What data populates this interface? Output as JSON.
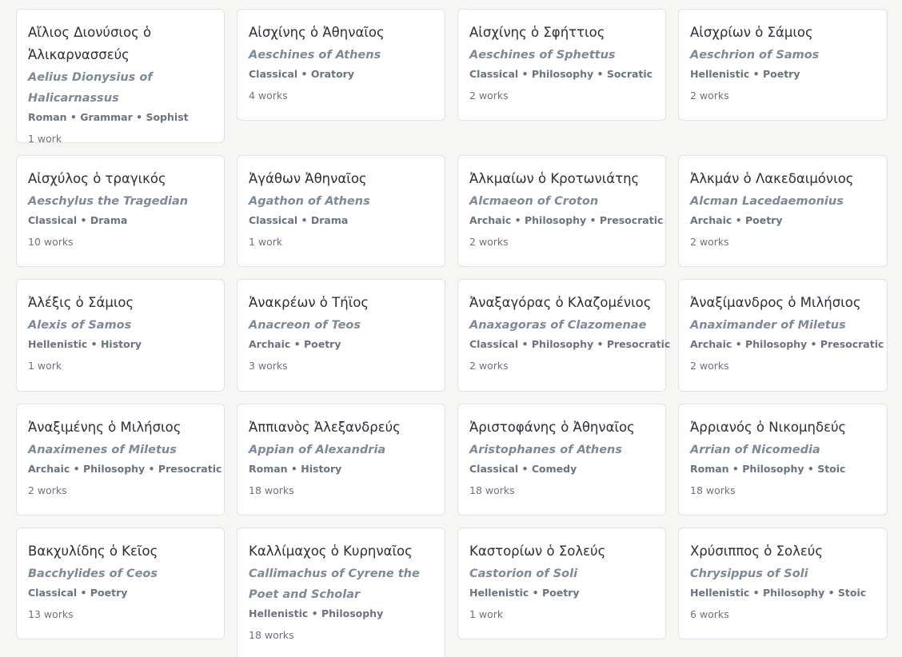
{
  "authors": [
    {
      "greek": "Αἴλιος Διονύσιος ὁ Ἁλικαρνασσεύς",
      "english": "Aelius Dionysius of Halicarnassus",
      "meta": "Roman • Grammar • Sophist",
      "works": "1 work"
    },
    {
      "greek": "Αἰσχίνης ὁ Ἀθηναῖος",
      "english": "Aeschines of Athens",
      "meta": "Classical • Oratory",
      "works": "4 works"
    },
    {
      "greek": "Αἰσχίνης ὁ Σφήττιος",
      "english": "Aeschines of Sphettus",
      "meta": "Classical • Philosophy • Socratic",
      "works": "2 works"
    },
    {
      "greek": "Αἰσχρίων ὁ Σάμιος",
      "english": "Aeschrion of Samos",
      "meta": "Hellenistic • Poetry",
      "works": "2 works"
    },
    {
      "greek": "Αἰσχύλος ὁ τραγικός",
      "english": "Aeschylus the Tragedian",
      "meta": "Classical • Drama",
      "works": "10 works"
    },
    {
      "greek": "Ἀγάθων Ἀθηναῖος",
      "english": "Agathon of Athens",
      "meta": "Classical • Drama",
      "works": "1 work"
    },
    {
      "greek": "Ἀλκμαίων ὁ Κροτωνιάτης",
      "english": "Alcmaeon of Croton",
      "meta": "Archaic • Philosophy • Presocratic",
      "works": "2 works"
    },
    {
      "greek": "Ἀλκμάν ὁ Λακεδαιμόνιος",
      "english": "Alcman Lacedaemonius",
      "meta": "Archaic • Poetry",
      "works": "2 works"
    },
    {
      "greek": "Ἀλέξις ὁ Σάμιος",
      "english": "Alexis of Samos",
      "meta": "Hellenistic • History",
      "works": "1 work"
    },
    {
      "greek": "Ἀνακρέων ὁ Τήϊος",
      "english": "Anacreon of Teos",
      "meta": "Archaic • Poetry",
      "works": "3 works"
    },
    {
      "greek": "Ἀναξαγόρας ὁ Κλαζομένιος",
      "english": "Anaxagoras of Clazomenae",
      "meta": "Classical • Philosophy • Presocratic",
      "works": "2 works"
    },
    {
      "greek": "Ἀναξίμανδρος ὁ Μιλήσιος",
      "english": "Anaximander of Miletus",
      "meta": "Archaic • Philosophy • Presocratic",
      "works": "2 works"
    },
    {
      "greek": "Ἀναξιμένης ὁ Μιλήσιος",
      "english": "Anaximenes of Miletus",
      "meta": "Archaic • Philosophy • Presocratic",
      "works": "2 works"
    },
    {
      "greek": "Ἀππιανὸς Ἀλεξανδρεύς",
      "english": "Appian of Alexandria",
      "meta": "Roman • History",
      "works": "18 works"
    },
    {
      "greek": "Ἀριστοφάνης ὁ Ἀθηναῖος",
      "english": "Aristophanes of Athens",
      "meta": "Classical • Comedy",
      "works": "18 works"
    },
    {
      "greek": "Ἀρριανός ὁ Νικομηδεύς",
      "english": "Arrian of Nicomedia",
      "meta": "Roman • Philosophy • Stoic",
      "works": "18 works"
    },
    {
      "greek": "Βακχυλίδης ὁ Κεῖος",
      "english": "Bacchylides of Ceos",
      "meta": "Classical • Poetry",
      "works": "13 works"
    },
    {
      "greek": "Καλλίμαχος ὁ Κυρηναῖος",
      "english": "Callimachus of Cyrene the Poet and Scholar",
      "meta": "Hellenistic • Philosophy",
      "works": "18 works"
    },
    {
      "greek": "Καστορίων ὁ Σολεύς",
      "english": "Castorion of Soli",
      "meta": "Hellenistic • Poetry",
      "works": "1 work"
    },
    {
      "greek": "Χρύσιππος ὁ Σολεύς",
      "english": "Chrysippus of Soli",
      "meta": "Hellenistic • Philosophy • Stoic",
      "works": "6 works"
    }
  ]
}
